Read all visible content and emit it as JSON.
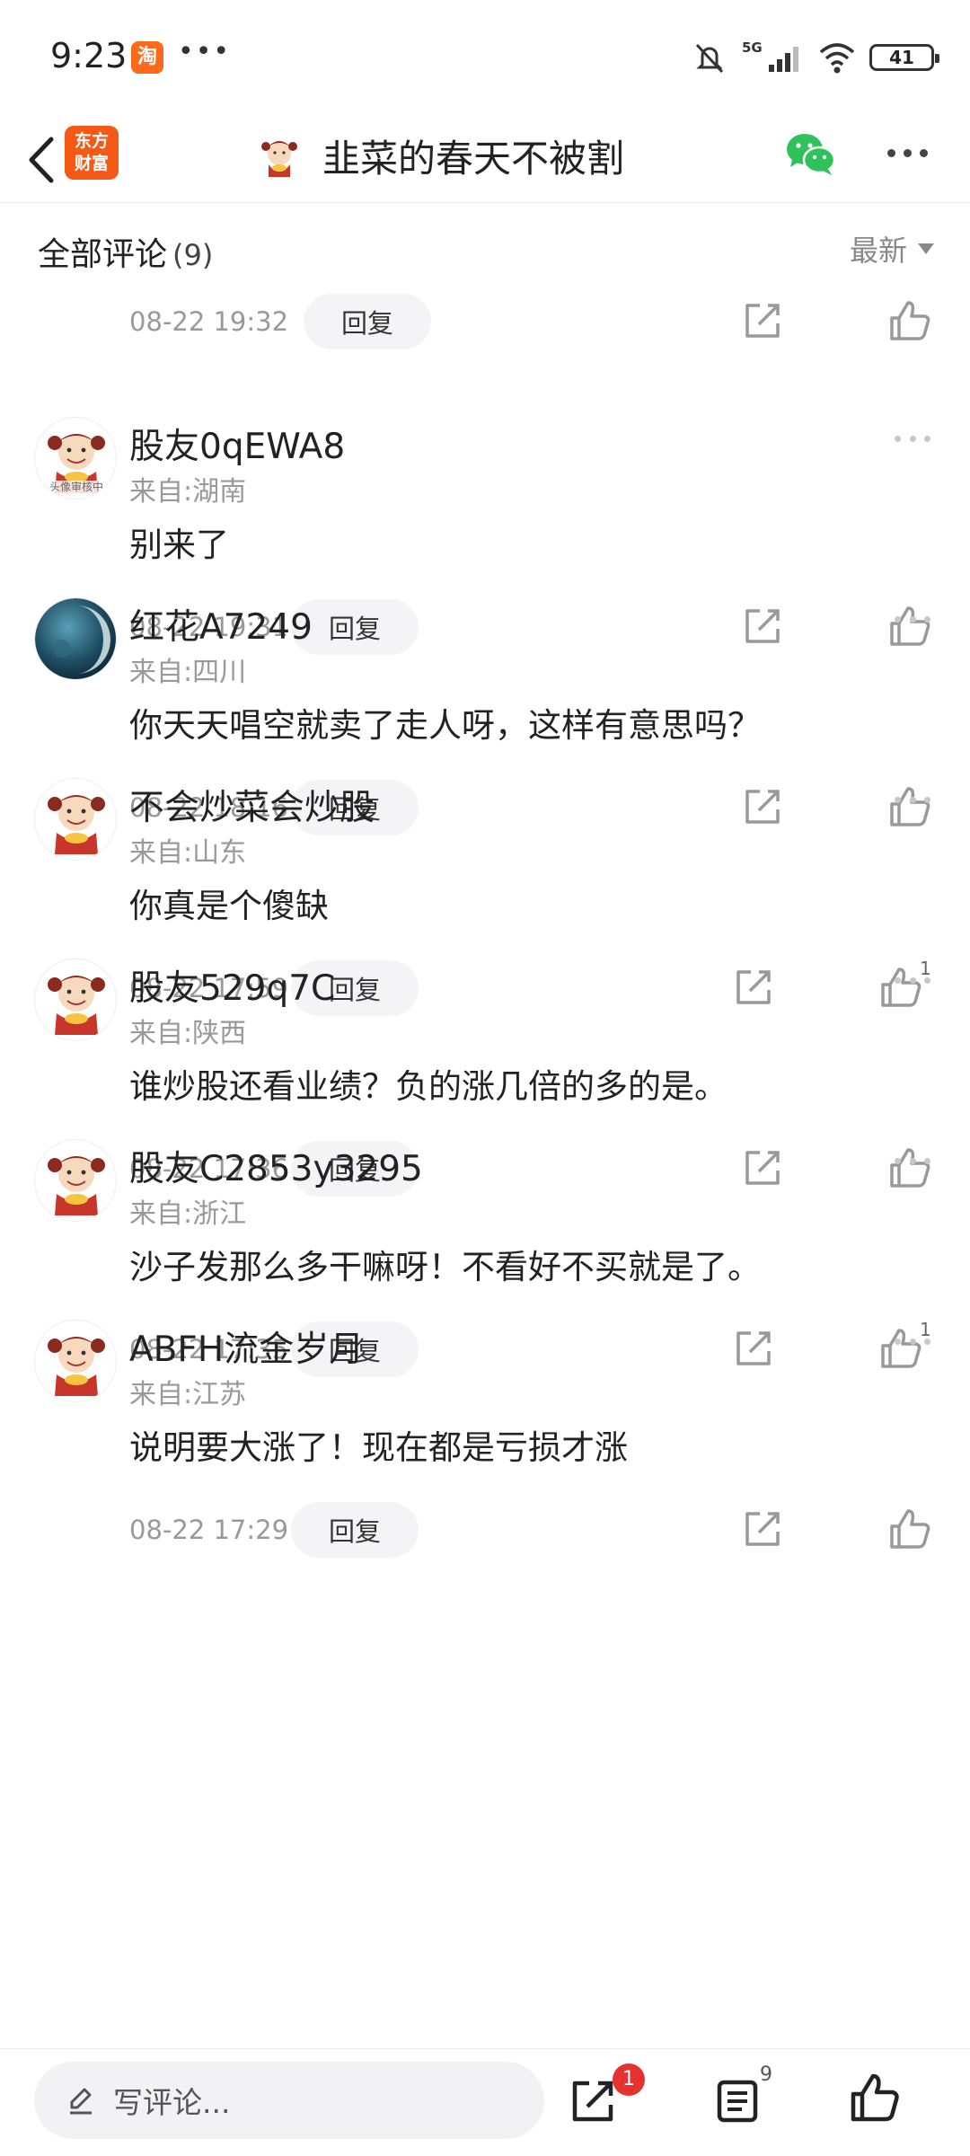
{
  "status_bar": {
    "time": "9:23",
    "taobao_glyph": "淘",
    "dots": "•••",
    "network": "5G",
    "battery": "41"
  },
  "topbar": {
    "logo_line1": "东方",
    "logo_line2": "财富",
    "title": "韭菜的春天不被割"
  },
  "comments_header": {
    "title": "全部评论",
    "count": "(9)",
    "sort_label": "最新"
  },
  "reply_label": "回复",
  "partial_row": {
    "time": "08-22 19:32"
  },
  "comments": [
    {
      "name": "股友0qEWA8",
      "location": "来自:湖南",
      "text": "别来了",
      "time": "08-22 19:31",
      "likes": "",
      "avatar": "mascot-review"
    },
    {
      "name": "红花A7249",
      "location": "来自:四川",
      "text": "你天天唱空就卖了走人呀，这样有意思吗？",
      "time": "08-22 18:16",
      "likes": "",
      "avatar": "moon-planet"
    },
    {
      "name": "不会炒菜会炒股",
      "location": "来自:山东",
      "text": "你真是个傻缺",
      "time": "08-22 17:59",
      "likes": "1",
      "avatar": "mascot"
    },
    {
      "name": "股友529q7C",
      "location": "来自:陕西",
      "text": "谁炒股还看业绩？负的涨几倍的多的是。",
      "time": "08-22 17:36",
      "likes": "",
      "avatar": "mascot"
    },
    {
      "name": "股友C2853y3295",
      "location": "来自:浙江",
      "text": "沙子发那么多干嘛呀！不看好不买就是了。",
      "time": "08-22 17:35",
      "likes": "1",
      "avatar": "mascot"
    },
    {
      "name": "ABFH流金岁月",
      "location": "来自:江苏",
      "text": "说明要大涨了！现在都是亏损才涨",
      "time": "08-22 17:29",
      "likes": "",
      "avatar": "mascot"
    }
  ],
  "avatar_review_text": "头像审核中",
  "bottom_bar": {
    "write_placeholder": "写评论...",
    "share_badge": "1",
    "list_count": "9"
  },
  "colors": {
    "accent_orange": "#f45a16",
    "badge_red": "#e63131",
    "wechat_green": "#2fc15a",
    "pill_bg": "#f4f4f6"
  }
}
